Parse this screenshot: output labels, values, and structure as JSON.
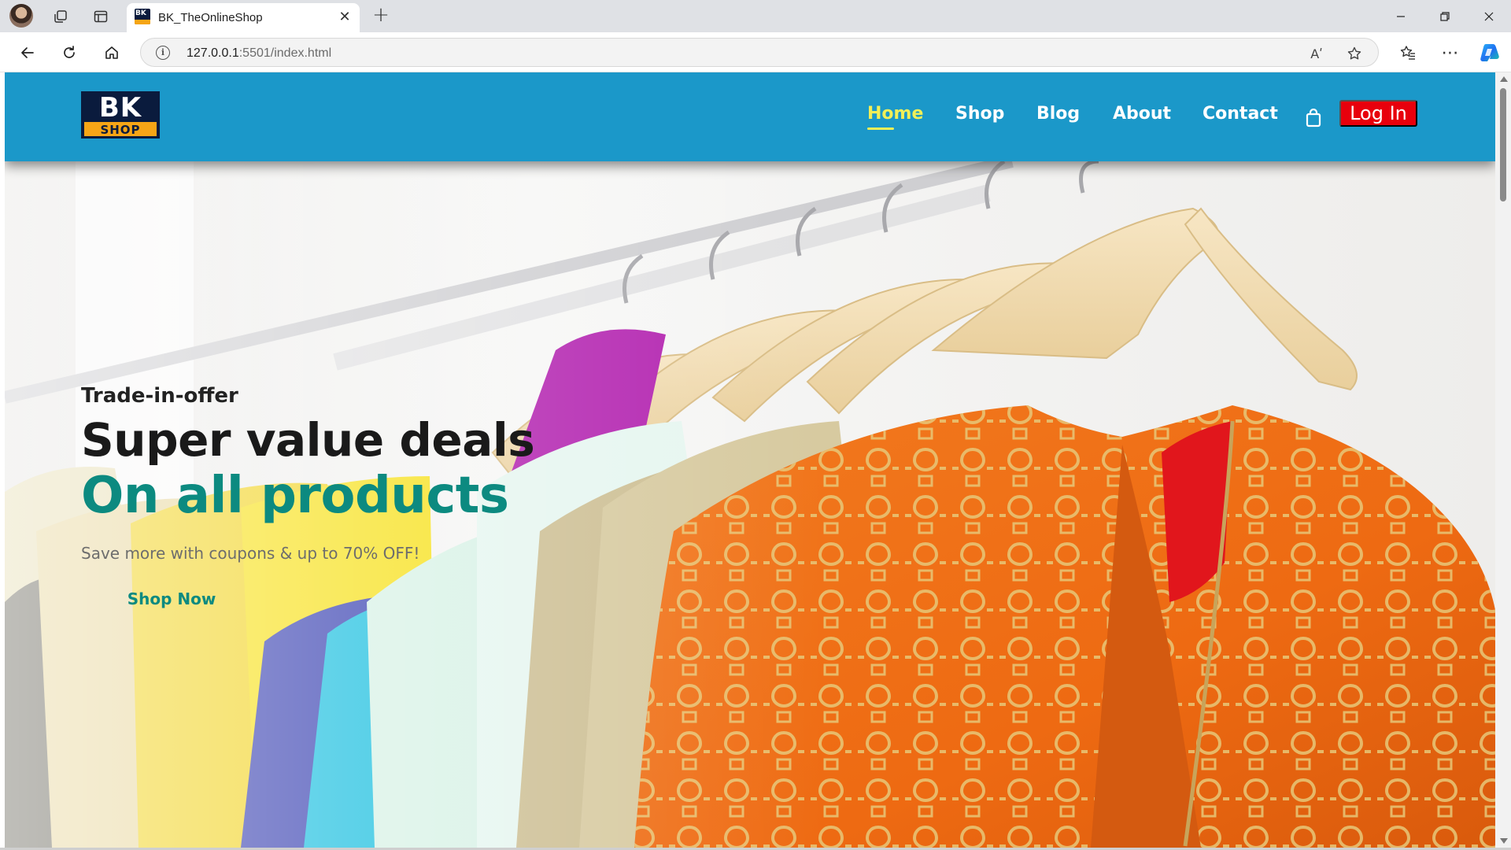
{
  "browser": {
    "tab_title": "BK_TheOnlineShop",
    "favicon_text": "BK",
    "url_host": "127.0.0.1",
    "url_path": ":5501/index.html",
    "read_aloud_label": "Aʹ",
    "icons": [
      "profile-avatar",
      "collections-icon",
      "tab-actions-icon",
      "close-icon",
      "plus-icon",
      "back-arrow-icon",
      "reload-icon",
      "home-icon",
      "info-icon",
      "read-aloud-icon",
      "star-icon",
      "favorites-icon",
      "more-icon",
      "copilot-icon",
      "minimize-icon",
      "restore-icon",
      "window-close-icon"
    ]
  },
  "site": {
    "logo_top": "BK",
    "logo_bottom": "SHOP",
    "nav": [
      {
        "label": "Home",
        "active": true
      },
      {
        "label": "Shop",
        "active": false
      },
      {
        "label": "Blog",
        "active": false
      },
      {
        "label": "About",
        "active": false
      },
      {
        "label": "Contact",
        "active": false
      }
    ],
    "cart_icon": "shopping-bag-icon",
    "login_label": "Log In",
    "colors": {
      "header_bg": "#1b98c9",
      "nav_active": "#f1ef57",
      "login_bg": "#e8000c",
      "accent_teal": "#0c8a80",
      "logo_navy": "#0a1b3d",
      "logo_orange": "#f6a516"
    }
  },
  "hero": {
    "kicker": "Trade-in-offer",
    "headline": "Super value deals",
    "headline_accent": "On all products",
    "subtext": "Save more with coupons & up to 70% OFF!",
    "cta_label": "Shop Now"
  }
}
